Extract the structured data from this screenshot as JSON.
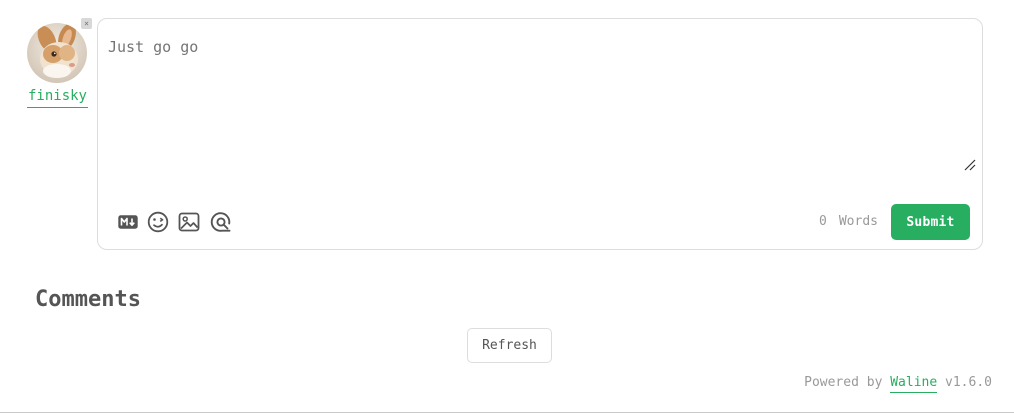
{
  "user": {
    "name": "finisky",
    "logout_symbol": "×",
    "avatar_icon": "rabbit-avatar"
  },
  "editor": {
    "value": "Just go go",
    "placeholder": "Just go go"
  },
  "toolbar": {
    "icons": [
      "markdown-icon",
      "emoji-icon",
      "image-icon",
      "preview-icon"
    ]
  },
  "footer": {
    "word_count": "0",
    "words_label": "Words",
    "submit_label": "Submit"
  },
  "comments": {
    "title": "Comments",
    "refresh_label": "Refresh"
  },
  "powered": {
    "prefix": "Powered by",
    "brand": "Waline",
    "version": "v1.6.0"
  },
  "colors": {
    "accent": "#27ae60",
    "text": "#555555",
    "muted": "#999999",
    "border": "#dddddd"
  }
}
